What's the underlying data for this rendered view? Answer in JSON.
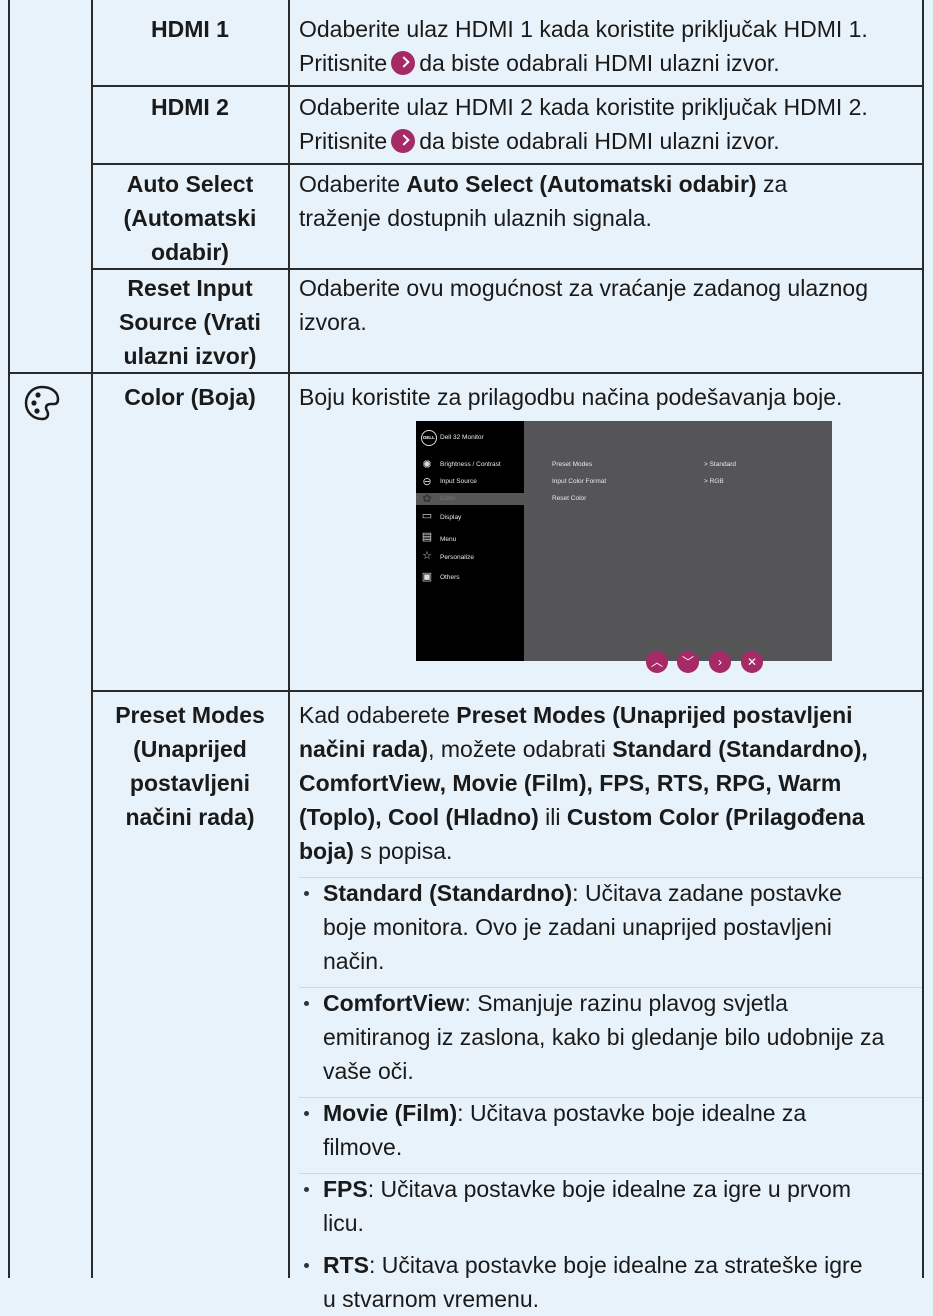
{
  "rows": {
    "hdmi1": {
      "name": "HDMI 1",
      "line1": "Odaberite ulaz HDMI 1 kada koristite priključak HDMI 1.",
      "line2_pre": "Pritisnite",
      "line2_post": "da biste odabrali HDMI ulazni izvor."
    },
    "hdmi2": {
      "name": "HDMI 2",
      "line1": "Odaberite ulaz HDMI 2 kada koristite priključak HDMI 2.",
      "line2_pre": "Pritisnite",
      "line2_post": "da biste odabrali HDMI ulazni izvor."
    },
    "auto": {
      "name_l1": "Auto Select",
      "name_l2": "(Automatski",
      "name_l3": "odabir)",
      "pre": "Odaberite",
      "bold": "Auto Select (Automatski odabir)",
      "post": "za",
      "line2": "traženje dostupnih ulaznih signala."
    },
    "reset": {
      "name_l1": "Reset Input",
      "name_l2": "Source (Vrati",
      "name_l3": "ulazni izvor)",
      "line1": "Odaberite ovu mogućnost za vraćanje zadanog ulaznog",
      "line2": "izvora."
    },
    "color": {
      "name": "Color (Boja)",
      "desc": "Boju koristite za prilagodbu načina podešavanja boje."
    },
    "preset": {
      "name_l1": "Preset Modes",
      "name_l2": "(Unaprijed",
      "name_l3": "postavljeni",
      "name_l4": "načini rada)",
      "intro_l1_pre": "Kad odaberete",
      "intro_l1_m": "Preset Modes (Unaprijed postavljeni",
      "intro_l2_m": "načini rada)",
      "intro_l2_post": ", možete odabrati",
      "intro_l2_m2": "Standard (Standardno),",
      "intro_l3_m": "ComfortView, Movie (Film), FPS, RTS, RPG, Warm",
      "intro_l4_m": "(Toplo), Cool (Hladno)",
      "intro_l4_mid": "ili",
      "intro_l4_m2": "Custom Color (Prilagođena",
      "intro_l5_m": "boja)",
      "intro_l5_post": "s popisa.",
      "b1_m": "Standard (Standardno)",
      "b1_l1": ": Učitava zadane postavke",
      "b1_l2": "boje monitora. Ovo je zadani unaprijed postavljeni",
      "b1_l3": "način.",
      "b2_m": "ComfortView",
      "b2_l1": ": Smanjuje razinu plavog svjetla",
      "b2_l2": "emitiranog iz zaslona, kako bi gledanje bilo udobnije za",
      "b2_l3": "vaše oči.",
      "b3_m": "Movie (Film)",
      "b3_l1": ": Učitava postavke boje idealne za",
      "b3_l2": "filmove.",
      "b4_m": "FPS",
      "b4_l1": ": Učitava postavke boje idealne za igre u prvom",
      "b4_l2": "licu.",
      "b5_m": "RTS",
      "b5_l1": ": Učitava postavke boje idealne za strateške igre",
      "b5_l2": "u stvarnom vremenu."
    }
  },
  "osd": {
    "logo": "DELL",
    "title": "Dell 32 Monitor",
    "menu": [
      "Brightness / Contrast",
      "Input Source",
      "Color",
      "Display",
      "Menu",
      "Personalize",
      "Others"
    ],
    "items": [
      {
        "label": "Preset Modes",
        "value": ">   Standard"
      },
      {
        "label": "Input Color Format",
        "value": ">   RGB"
      },
      {
        "label": "Reset Color",
        "value": ""
      }
    ]
  },
  "nav_buttons": [
    "up",
    "down",
    "right",
    "close"
  ],
  "accent": "#a62a66"
}
